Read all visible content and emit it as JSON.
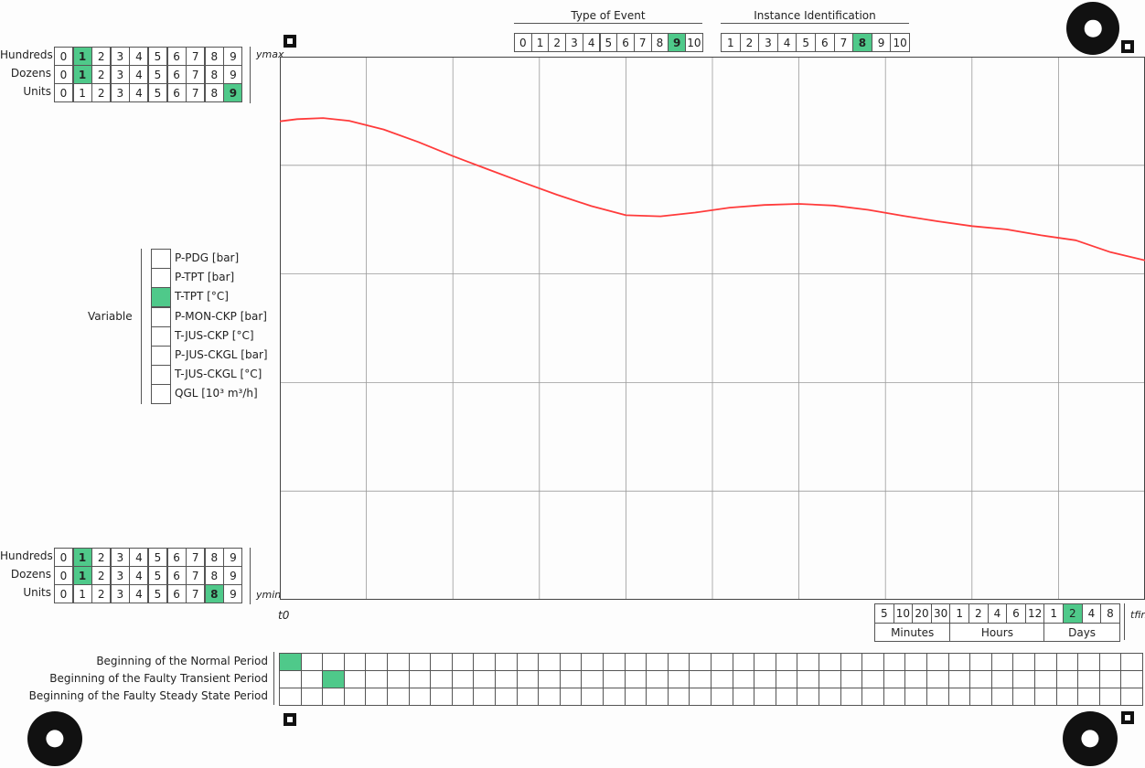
{
  "top_scale": {
    "rows": [
      {
        "label": "Hundreds",
        "cells": [
          "0",
          "1",
          "2",
          "3",
          "4",
          "5",
          "6",
          "7",
          "8",
          "9"
        ],
        "marked": 1
      },
      {
        "label": "Dozens",
        "cells": [
          "0",
          "1",
          "2",
          "3",
          "4",
          "5",
          "6",
          "7",
          "8",
          "9"
        ],
        "marked": 1
      },
      {
        "label": "Units",
        "cells": [
          "0",
          "1",
          "2",
          "3",
          "4",
          "5",
          "6",
          "7",
          "8",
          "9"
        ],
        "marked": 9
      }
    ],
    "axis_label": "ymax"
  },
  "bottom_scale": {
    "rows": [
      {
        "label": "Hundreds",
        "cells": [
          "0",
          "1",
          "2",
          "3",
          "4",
          "5",
          "6",
          "7",
          "8",
          "9"
        ],
        "marked": 1
      },
      {
        "label": "Dozens",
        "cells": [
          "0",
          "1",
          "2",
          "3",
          "4",
          "5",
          "6",
          "7",
          "8",
          "9"
        ],
        "marked": 1
      },
      {
        "label": "Units",
        "cells": [
          "0",
          "1",
          "2",
          "3",
          "4",
          "5",
          "6",
          "7",
          "8",
          "9"
        ],
        "marked": 8
      }
    ],
    "axis_label": "ymin"
  },
  "type_of_event": {
    "title": "Type of Event",
    "cells": [
      "0",
      "1",
      "2",
      "3",
      "4",
      "5",
      "6",
      "7",
      "8",
      "9",
      "10"
    ],
    "marked": 9
  },
  "instance_identification": {
    "title": "Instance Identification",
    "cells": [
      "1",
      "2",
      "3",
      "4",
      "5",
      "6",
      "7",
      "8",
      "9",
      "10"
    ],
    "marked": 7
  },
  "variable": {
    "title": "Variable",
    "items": [
      "P-PDG [bar]",
      "P-TPT [bar]",
      "T-TPT [°C]",
      "P-MON-CKP [bar]",
      "T-JUS-CKP [°C]",
      "P-JUS-CKGL [bar]",
      "T-JUS-CKGL [°C]",
      "QGL [10³ m³/h]"
    ],
    "marked": 2
  },
  "time_scale": {
    "start_label": "t0",
    "end_label": "tfin",
    "cells": [
      "5",
      "10",
      "20",
      "30",
      "1",
      "2",
      "4",
      "6",
      "12",
      "1",
      "2",
      "4",
      "8"
    ],
    "groups": [
      "Minutes",
      "Hours",
      "Days"
    ],
    "marked": 10
  },
  "periods": {
    "rows": [
      {
        "label": "Beginning of the Normal Period",
        "marked": 0
      },
      {
        "label": "Beginning of the Faulty Transient Period",
        "marked": 2
      },
      {
        "label": "Beginning of the Faulty Steady State Period",
        "marked": -1
      }
    ],
    "columns": 40
  },
  "chart_data": {
    "type": "line",
    "title": "",
    "xlabel": "",
    "ylabel": "",
    "x": [
      0.0,
      0.02,
      0.05,
      0.08,
      0.12,
      0.16,
      0.2,
      0.24,
      0.28,
      0.32,
      0.36,
      0.4,
      0.44,
      0.48,
      0.52,
      0.56,
      0.6,
      0.64,
      0.68,
      0.72,
      0.76,
      0.8,
      0.84,
      0.88,
      0.92,
      0.96,
      1.0
    ],
    "series": [
      {
        "color": "#ff3b3b",
        "values": [
          0.881,
          0.885,
          0.887,
          0.882,
          0.866,
          0.843,
          0.817,
          0.793,
          0.769,
          0.746,
          0.725,
          0.708,
          0.706,
          0.713,
          0.722,
          0.727,
          0.729,
          0.726,
          0.718,
          0.707,
          0.697,
          0.688,
          0.682,
          0.671,
          0.662,
          0.64,
          0.625
        ]
      }
    ],
    "ylim": [
      0,
      1
    ],
    "xlim": [
      0,
      1
    ],
    "grid": true
  }
}
